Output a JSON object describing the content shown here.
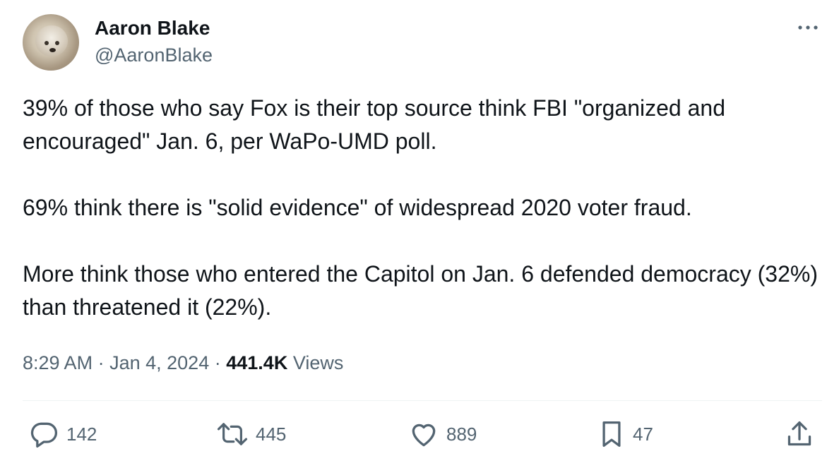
{
  "author": {
    "name": "Aaron Blake",
    "handle": "@AaronBlake"
  },
  "tweet": {
    "paragraphs": [
      "39% of those who say Fox is their top source think FBI \"organized and encouraged\" Jan. 6, per WaPo-UMD poll.",
      "69% think there is \"solid evidence\" of widespread 2020 voter fraud.",
      "More think those who entered the Capitol on Jan. 6 defended democracy (32%) than threatened it (22%)."
    ],
    "time": "8:29 AM",
    "separator": "·",
    "date": "Jan 4, 2024",
    "views_count": "441.4K",
    "views_label": "Views"
  },
  "actions": {
    "replies": "142",
    "reposts": "445",
    "likes": "889",
    "bookmarks": "47"
  },
  "icons": {
    "more": "more-dots-icon",
    "reply": "reply-bubble-icon",
    "repost": "repost-arrows-icon",
    "like": "heart-icon",
    "bookmark": "bookmark-icon",
    "share": "share-upload-icon"
  },
  "colors": {
    "text": "#0f1419",
    "secondary": "#536471",
    "divider": "#eff3f4"
  }
}
